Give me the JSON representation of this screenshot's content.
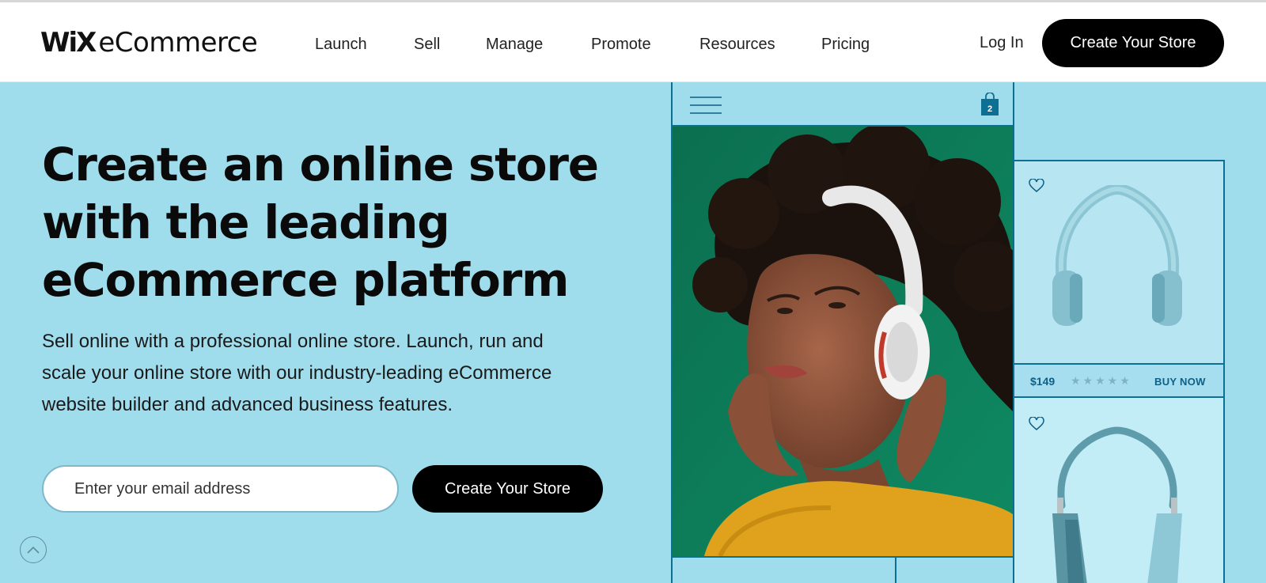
{
  "brand": {
    "wix": "WiX",
    "ecommerce": "eCommerce"
  },
  "nav": {
    "items": [
      {
        "label": "Launch"
      },
      {
        "label": "Sell"
      },
      {
        "label": "Manage"
      },
      {
        "label": "Promote"
      },
      {
        "label": "Resources"
      },
      {
        "label": "Pricing"
      }
    ],
    "login": "Log In",
    "cta": "Create Your Store"
  },
  "hero": {
    "headline": [
      "Create an online store",
      "with the leading",
      "eCommerce platform"
    ],
    "subtext": [
      "Sell online with a professional online store. Launch, run and",
      "scale your online store with our industry-leading eCommerce",
      "website builder and advanced business features."
    ],
    "email_placeholder": "Enter your email address",
    "cta": "Create Your Store"
  },
  "mockup": {
    "cart_count": "2",
    "product": {
      "price": "$149",
      "rating": "★★★★★",
      "buy_label": "BUY NOW"
    }
  },
  "icons": {
    "menu": "hamburger-menu-icon",
    "cart": "shopping-bag-icon",
    "favorite": "heart-icon",
    "scroll_top": "chevron-up-icon"
  },
  "colors": {
    "hero_bg": "#9fdcec",
    "accent_line": "#0e6f94",
    "button_bg": "#000000",
    "photo_bg": "#0e7a56"
  }
}
